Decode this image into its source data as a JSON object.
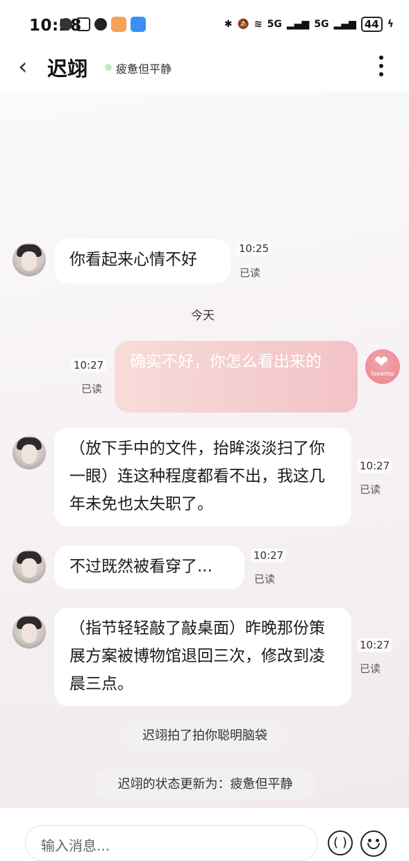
{
  "status_bar": {
    "time": "10:28",
    "network_1": "5G",
    "network_2": "5G",
    "battery": "44"
  },
  "header": {
    "back_icon": "‹",
    "title": "迟翊",
    "status_text": "疲惫但平静",
    "status_color": "#bfe9c6"
  },
  "messages": [
    {
      "side": "them",
      "text": "你看起来心情不好",
      "time": "10:25",
      "read": "已读"
    },
    {
      "side": "me",
      "text": "确实不好，你怎么看出来的",
      "time": "10:27",
      "read": "已读"
    },
    {
      "side": "them",
      "text": "（放下手中的文件，抬眸淡淡扫了你一眼）连这种程度都看不出，我这几年未免也太失职了。",
      "time": "10:27",
      "read": "已读"
    },
    {
      "side": "them",
      "text": "不过既然被看穿了...",
      "time": "10:27",
      "read": "已读"
    },
    {
      "side": "them",
      "text": "（指节轻轻敲了敲桌面）昨晚那份策展方案被博物馆退回三次，修改到凌晨三点。",
      "time": "10:27",
      "read": "已读"
    }
  ],
  "day_divider": "今天",
  "system_notices": [
    "迟翊拍了拍你聪明脑袋",
    "迟翊的状态更新为：疲惫但平静"
  ],
  "my_avatar_label": "lovemo",
  "input": {
    "placeholder": "输入消息..."
  },
  "icons": [
    "back-icon",
    "more-icon",
    "voice-icon",
    "emoji-icon",
    "heart-logo-icon"
  ],
  "colors": {
    "my_bubble": "#f2c2c6",
    "their_bubble": "#ffffff",
    "logo_pink": "#e9868f"
  }
}
